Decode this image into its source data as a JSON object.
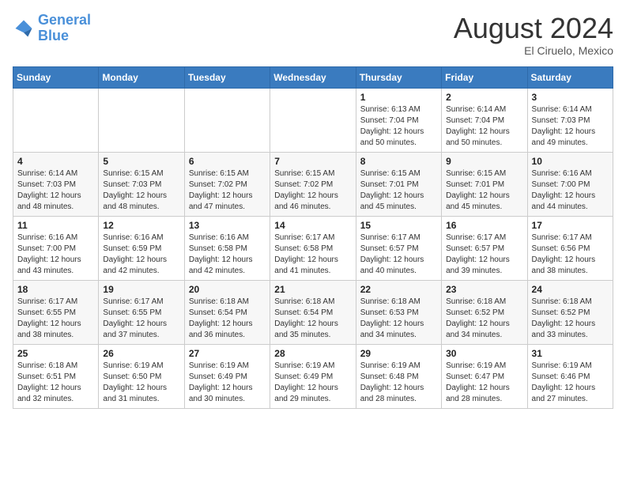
{
  "logo": {
    "line1": "General",
    "line2": "Blue"
  },
  "title": "August 2024",
  "subtitle": "El Ciruelo, Mexico",
  "days_header": [
    "Sunday",
    "Monday",
    "Tuesday",
    "Wednesday",
    "Thursday",
    "Friday",
    "Saturday"
  ],
  "weeks": [
    [
      {
        "day": "",
        "info": ""
      },
      {
        "day": "",
        "info": ""
      },
      {
        "day": "",
        "info": ""
      },
      {
        "day": "",
        "info": ""
      },
      {
        "day": "1",
        "info": "Sunrise: 6:13 AM\nSunset: 7:04 PM\nDaylight: 12 hours and 50 minutes."
      },
      {
        "day": "2",
        "info": "Sunrise: 6:14 AM\nSunset: 7:04 PM\nDaylight: 12 hours and 50 minutes."
      },
      {
        "day": "3",
        "info": "Sunrise: 6:14 AM\nSunset: 7:03 PM\nDaylight: 12 hours and 49 minutes."
      }
    ],
    [
      {
        "day": "4",
        "info": "Sunrise: 6:14 AM\nSunset: 7:03 PM\nDaylight: 12 hours and 48 minutes."
      },
      {
        "day": "5",
        "info": "Sunrise: 6:15 AM\nSunset: 7:03 PM\nDaylight: 12 hours and 48 minutes."
      },
      {
        "day": "6",
        "info": "Sunrise: 6:15 AM\nSunset: 7:02 PM\nDaylight: 12 hours and 47 minutes."
      },
      {
        "day": "7",
        "info": "Sunrise: 6:15 AM\nSunset: 7:02 PM\nDaylight: 12 hours and 46 minutes."
      },
      {
        "day": "8",
        "info": "Sunrise: 6:15 AM\nSunset: 7:01 PM\nDaylight: 12 hours and 45 minutes."
      },
      {
        "day": "9",
        "info": "Sunrise: 6:15 AM\nSunset: 7:01 PM\nDaylight: 12 hours and 45 minutes."
      },
      {
        "day": "10",
        "info": "Sunrise: 6:16 AM\nSunset: 7:00 PM\nDaylight: 12 hours and 44 minutes."
      }
    ],
    [
      {
        "day": "11",
        "info": "Sunrise: 6:16 AM\nSunset: 7:00 PM\nDaylight: 12 hours and 43 minutes."
      },
      {
        "day": "12",
        "info": "Sunrise: 6:16 AM\nSunset: 6:59 PM\nDaylight: 12 hours and 42 minutes."
      },
      {
        "day": "13",
        "info": "Sunrise: 6:16 AM\nSunset: 6:58 PM\nDaylight: 12 hours and 42 minutes."
      },
      {
        "day": "14",
        "info": "Sunrise: 6:17 AM\nSunset: 6:58 PM\nDaylight: 12 hours and 41 minutes."
      },
      {
        "day": "15",
        "info": "Sunrise: 6:17 AM\nSunset: 6:57 PM\nDaylight: 12 hours and 40 minutes."
      },
      {
        "day": "16",
        "info": "Sunrise: 6:17 AM\nSunset: 6:57 PM\nDaylight: 12 hours and 39 minutes."
      },
      {
        "day": "17",
        "info": "Sunrise: 6:17 AM\nSunset: 6:56 PM\nDaylight: 12 hours and 38 minutes."
      }
    ],
    [
      {
        "day": "18",
        "info": "Sunrise: 6:17 AM\nSunset: 6:55 PM\nDaylight: 12 hours and 38 minutes."
      },
      {
        "day": "19",
        "info": "Sunrise: 6:17 AM\nSunset: 6:55 PM\nDaylight: 12 hours and 37 minutes."
      },
      {
        "day": "20",
        "info": "Sunrise: 6:18 AM\nSunset: 6:54 PM\nDaylight: 12 hours and 36 minutes."
      },
      {
        "day": "21",
        "info": "Sunrise: 6:18 AM\nSunset: 6:54 PM\nDaylight: 12 hours and 35 minutes."
      },
      {
        "day": "22",
        "info": "Sunrise: 6:18 AM\nSunset: 6:53 PM\nDaylight: 12 hours and 34 minutes."
      },
      {
        "day": "23",
        "info": "Sunrise: 6:18 AM\nSunset: 6:52 PM\nDaylight: 12 hours and 34 minutes."
      },
      {
        "day": "24",
        "info": "Sunrise: 6:18 AM\nSunset: 6:52 PM\nDaylight: 12 hours and 33 minutes."
      }
    ],
    [
      {
        "day": "25",
        "info": "Sunrise: 6:18 AM\nSunset: 6:51 PM\nDaylight: 12 hours and 32 minutes."
      },
      {
        "day": "26",
        "info": "Sunrise: 6:19 AM\nSunset: 6:50 PM\nDaylight: 12 hours and 31 minutes."
      },
      {
        "day": "27",
        "info": "Sunrise: 6:19 AM\nSunset: 6:49 PM\nDaylight: 12 hours and 30 minutes."
      },
      {
        "day": "28",
        "info": "Sunrise: 6:19 AM\nSunset: 6:49 PM\nDaylight: 12 hours and 29 minutes."
      },
      {
        "day": "29",
        "info": "Sunrise: 6:19 AM\nSunset: 6:48 PM\nDaylight: 12 hours and 28 minutes."
      },
      {
        "day": "30",
        "info": "Sunrise: 6:19 AM\nSunset: 6:47 PM\nDaylight: 12 hours and 28 minutes."
      },
      {
        "day": "31",
        "info": "Sunrise: 6:19 AM\nSunset: 6:46 PM\nDaylight: 12 hours and 27 minutes."
      }
    ]
  ]
}
